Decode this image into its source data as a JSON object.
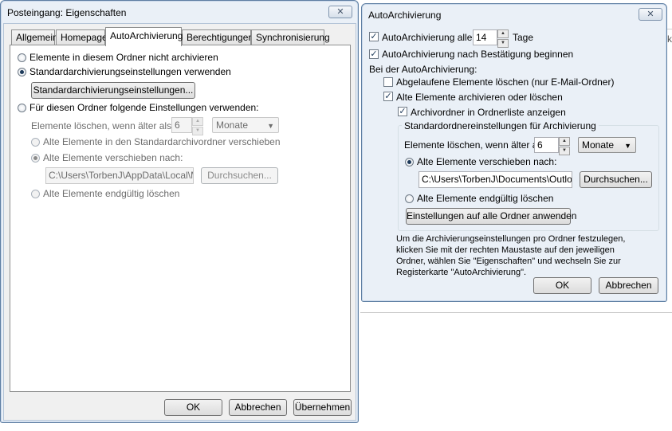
{
  "background": {
    "edge_text": "k"
  },
  "left_dialog": {
    "title": "Posteingang: Eigenschaften",
    "close_glyph": "✕",
    "tabs": [
      "Allgemein",
      "Homepage",
      "AutoArchivierung",
      "Berechtigungen",
      "Synchronisierung"
    ],
    "active_tab": "AutoArchivierung",
    "radio_no_archive": "Elemente in diesem Ordner nicht archivieren",
    "radio_default": "Standardarchivierungseinstellungen verwenden",
    "default_settings_button": "Standardarchivierungseinstellungen...",
    "radio_custom": "Für diesen Ordner folgende Einstellungen verwenden:",
    "delete_older_label": "Elemente löschen, wenn älter als",
    "age_value": "6",
    "age_unit": "Monate",
    "move_default_label": "Alte Elemente in den Standardarchivordner verschieben",
    "move_to_label": "Alte Elemente verschieben nach:",
    "path_value": "C:\\Users\\TorbenJ\\AppData\\Local\\Micr",
    "browse_button": "Durchsuchen...",
    "delete_permanently_label": "Alte Elemente endgültig löschen",
    "ok_button": "OK",
    "cancel_button": "Abbrechen",
    "apply_button": "Übernehmen"
  },
  "right_dialog": {
    "title": "AutoArchivierung",
    "close_glyph": "✕",
    "autoarchive_every_label": "AutoArchivierung alle",
    "autoarchive_every_value": "14",
    "autoarchive_every_unit": "Tage",
    "confirm_label": "AutoArchivierung nach Bestätigung beginnen",
    "during_label": "Bei der AutoArchivierung:",
    "delete_expired_label": "Abgelaufene Elemente löschen (nur E-Mail-Ordner)",
    "archive_or_delete_label": "Alte Elemente archivieren oder löschen",
    "show_archive_folder_label": "Archivordner in Ordnerliste anzeigen",
    "group_title": "Standardordnereinstellungen für Archivierung",
    "delete_older_label": "Elemente löschen, wenn älter als",
    "age_value": "6",
    "age_unit": "Monate",
    "move_to_label": "Alte Elemente verschieben nach:",
    "path_value": "C:\\Users\\TorbenJ\\Documents\\Outlook-",
    "browse_button": "Durchsuchen...",
    "delete_permanently_label": "Alte Elemente endgültig löschen",
    "apply_all_button": "Einstellungen auf alle Ordner anwenden",
    "info_lines": [
      "Um die Archivierungseinstellungen pro Ordner festzulegen,",
      "klicken Sie mit der rechten Maustaste auf den jeweiligen",
      "Ordner, wählen Sie \"Eigenschaften\" und wechseln Sie zur",
      "Registerkarte \"AutoArchivierung\"."
    ],
    "ok_button": "OK",
    "cancel_button": "Abbrechen"
  },
  "colors": {
    "window_frame": "#eaf0f7",
    "window_border": "#5f7fa3",
    "client_bg": "#f0f0f0",
    "panel_bg": "#ffffff"
  }
}
